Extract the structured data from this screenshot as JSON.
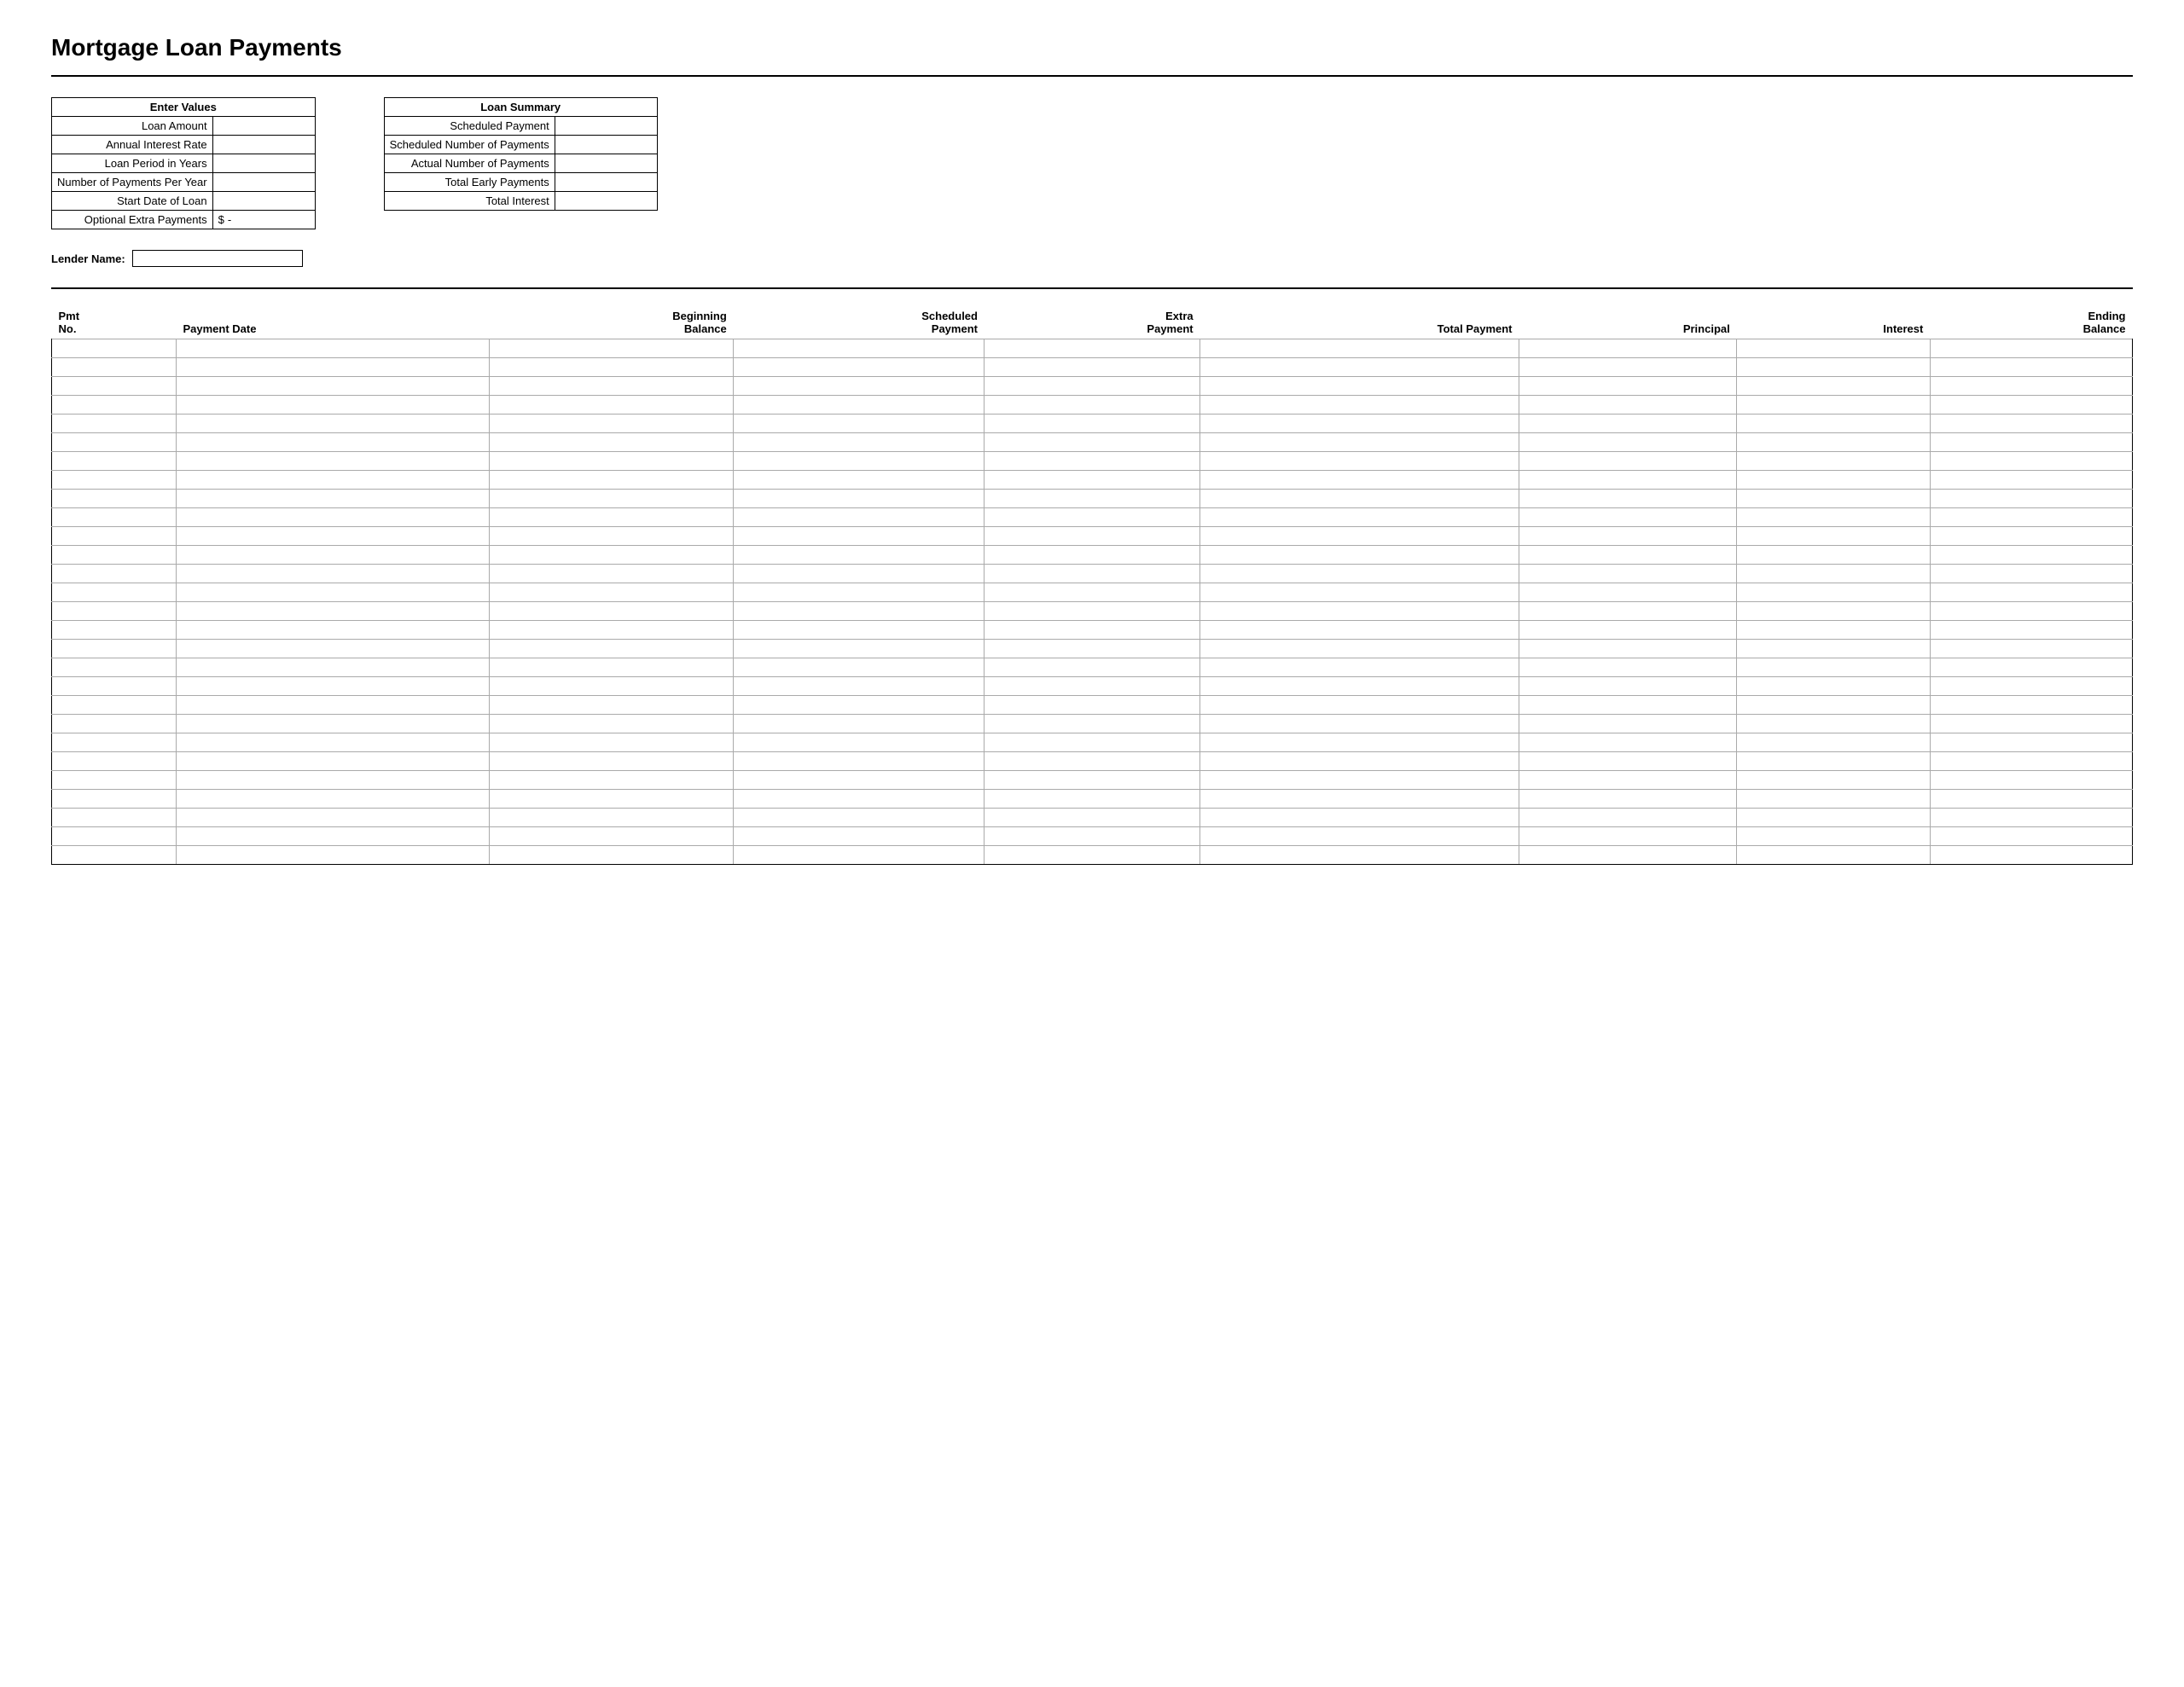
{
  "page": {
    "title": "Mortgage Loan Payments"
  },
  "enter_values": {
    "header": "Enter Values",
    "fields": [
      {
        "label": "Loan Amount",
        "value": ""
      },
      {
        "label": "Annual Interest Rate",
        "value": ""
      },
      {
        "label": "Loan Period in Years",
        "value": ""
      },
      {
        "label": "Number of Payments Per Year",
        "value": ""
      },
      {
        "label": "Start Date of Loan",
        "value": ""
      },
      {
        "label": "Optional Extra Payments",
        "prefix": "$",
        "value": "-"
      }
    ]
  },
  "loan_summary": {
    "header": "Loan Summary",
    "fields": [
      {
        "label": "Scheduled Payment",
        "value": ""
      },
      {
        "label": "Scheduled Number of Payments",
        "value": ""
      },
      {
        "label": "Actual Number of Payments",
        "value": ""
      },
      {
        "label": "Total Early Payments",
        "value": ""
      },
      {
        "label": "Total Interest",
        "value": ""
      }
    ]
  },
  "lender": {
    "label": "Lender Name:",
    "value": ""
  },
  "payment_table": {
    "columns": [
      {
        "line1": "Pmt",
        "line2": "No."
      },
      {
        "line1": "",
        "line2": "Payment Date"
      },
      {
        "line1": "Beginning",
        "line2": "Balance"
      },
      {
        "line1": "Scheduled",
        "line2": "Payment"
      },
      {
        "line1": "Extra",
        "line2": "Payment"
      },
      {
        "line1": "",
        "line2": "Total Payment"
      },
      {
        "line1": "",
        "line2": "Principal"
      },
      {
        "line1": "",
        "line2": "Interest"
      },
      {
        "line1": "Ending",
        "line2": "Balance"
      }
    ],
    "rows": 28
  }
}
